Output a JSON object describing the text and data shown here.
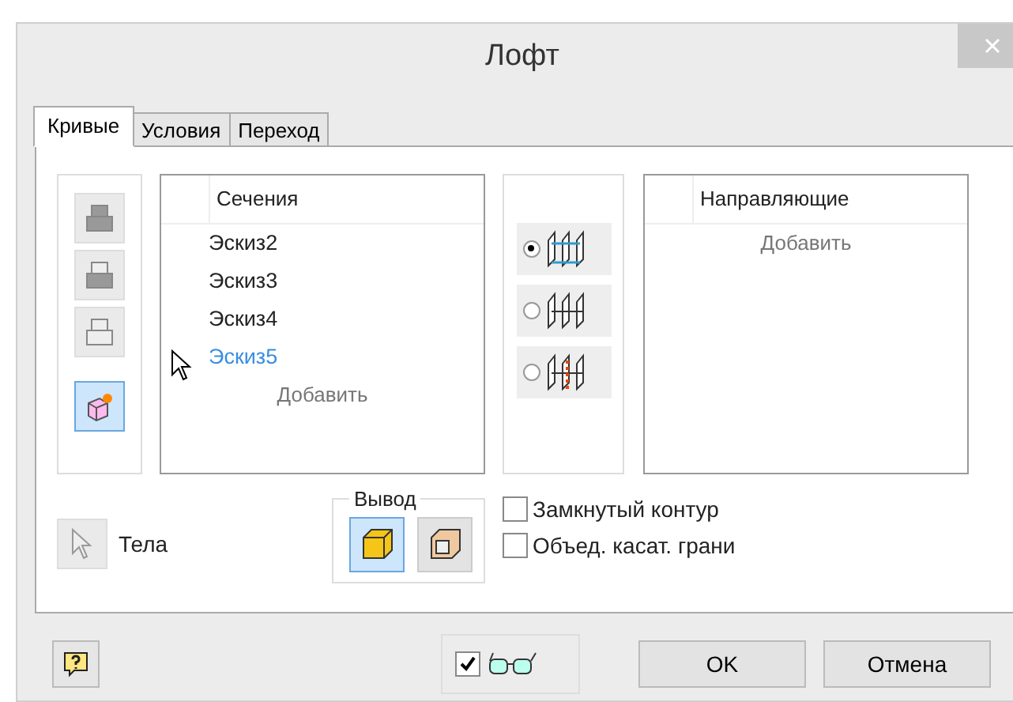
{
  "window": {
    "title": "Лофт"
  },
  "tabs": [
    {
      "label": "Кривые",
      "selected": true
    },
    {
      "label": "Условия",
      "selected": false
    },
    {
      "label": "Переход",
      "selected": false
    }
  ],
  "section_tools": [
    {
      "kind": "up",
      "selected": false
    },
    {
      "kind": "down",
      "selected": false
    },
    {
      "kind": "delete",
      "selected": false
    },
    {
      "kind": "point",
      "selected": true
    }
  ],
  "sections": {
    "header": "Сечения",
    "items": [
      {
        "label": "Эскиз2",
        "selected": false
      },
      {
        "label": "Эскиз3",
        "selected": false
      },
      {
        "label": "Эскиз4",
        "selected": false
      },
      {
        "label": "Эскиз5",
        "selected": true
      }
    ],
    "add": "Добавить"
  },
  "modes": [
    {
      "kind": "rails",
      "selected": true
    },
    {
      "kind": "centerline",
      "selected": false
    },
    {
      "kind": "area",
      "selected": false
    }
  ],
  "guides": {
    "header": "Направляющие",
    "add": "Добавить"
  },
  "bodies": {
    "label": "Тела"
  },
  "output": {
    "legend": "Вывод",
    "options": [
      {
        "kind": "solid",
        "selected": true
      },
      {
        "kind": "surface",
        "selected": false
      }
    ]
  },
  "options": [
    {
      "label": "Замкнутый контур",
      "checked": false
    },
    {
      "label": "Объед. касат. грани",
      "checked": false
    }
  ],
  "preview": {
    "checked": true
  },
  "buttons": [
    "OK",
    "Отмена"
  ]
}
